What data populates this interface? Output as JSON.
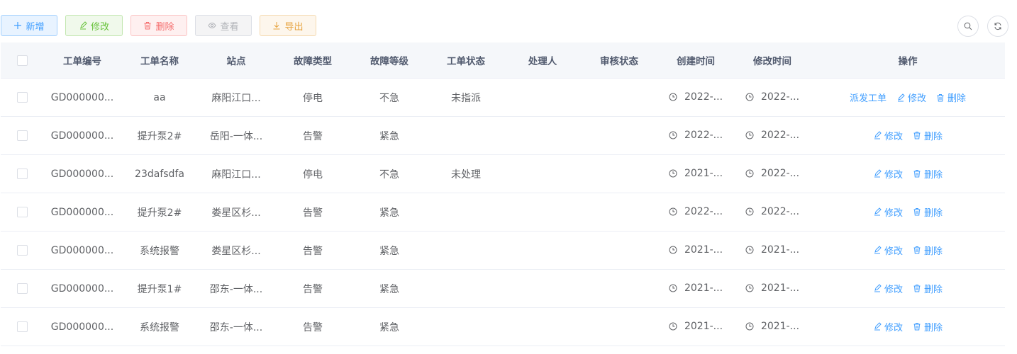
{
  "toolbar": {
    "add_label": "新增",
    "edit_label": "修改",
    "delete_label": "删除",
    "view_label": "查看",
    "export_label": "导出",
    "right_icons": [
      "search-icon",
      "refresh-icon"
    ]
  },
  "colors": {
    "primary": "#409eff",
    "success": "#67c23a",
    "danger": "#f56c6c",
    "info": "#b1b3b8",
    "warning": "#e6a23c",
    "header_bg": "#f5f7fa",
    "border": "#ebeef5"
  },
  "table": {
    "columns": [
      "工单编号",
      "工单名称",
      "站点",
      "故障类型",
      "故障等级",
      "工单状态",
      "处理人",
      "审核状态",
      "创建时间",
      "修改时间",
      "操作"
    ],
    "rows": [
      {
        "code": "GD000000...",
        "name": "aa",
        "site": "麻阳江口...",
        "fault_type": "停电",
        "level": "不急",
        "status": "未指派",
        "handler": "",
        "audit": "",
        "created": "2022-...",
        "modified": "2022-...",
        "actions": [
          "派发工单",
          "修改",
          "删除"
        ]
      },
      {
        "code": "GD000000...",
        "name": "提升泵2#",
        "site": "岳阳-一体...",
        "fault_type": "告警",
        "level": "紧急",
        "status": "",
        "handler": "",
        "audit": "",
        "created": "2022-...",
        "modified": "2022-...",
        "actions": [
          "修改",
          "删除"
        ]
      },
      {
        "code": "GD000000...",
        "name": "23dafsdfa",
        "site": "麻阳江口...",
        "fault_type": "停电",
        "level": "不急",
        "status": "未处理",
        "handler": "",
        "audit": "",
        "created": "2021-...",
        "modified": "2022-...",
        "actions": [
          "修改",
          "删除"
        ]
      },
      {
        "code": "GD000000...",
        "name": "提升泵2#",
        "site": "娄星区杉...",
        "fault_type": "告警",
        "level": "紧急",
        "status": "",
        "handler": "",
        "audit": "",
        "created": "2022-...",
        "modified": "2022-...",
        "actions": [
          "修改",
          "删除"
        ]
      },
      {
        "code": "GD000000...",
        "name": "系统报警",
        "site": "娄星区杉...",
        "fault_type": "告警",
        "level": "紧急",
        "status": "",
        "handler": "",
        "audit": "",
        "created": "2021-...",
        "modified": "2021-...",
        "actions": [
          "修改",
          "删除"
        ]
      },
      {
        "code": "GD000000...",
        "name": "提升泵1#",
        "site": "邵东-一体...",
        "fault_type": "告警",
        "level": "紧急",
        "status": "",
        "handler": "",
        "audit": "",
        "created": "2021-...",
        "modified": "2021-...",
        "actions": [
          "修改",
          "删除"
        ]
      },
      {
        "code": "GD000000...",
        "name": "系统报警",
        "site": "邵东-一体...",
        "fault_type": "告警",
        "level": "紧急",
        "status": "",
        "handler": "",
        "audit": "",
        "created": "2021-...",
        "modified": "2021-...",
        "actions": [
          "修改",
          "删除"
        ]
      }
    ]
  }
}
